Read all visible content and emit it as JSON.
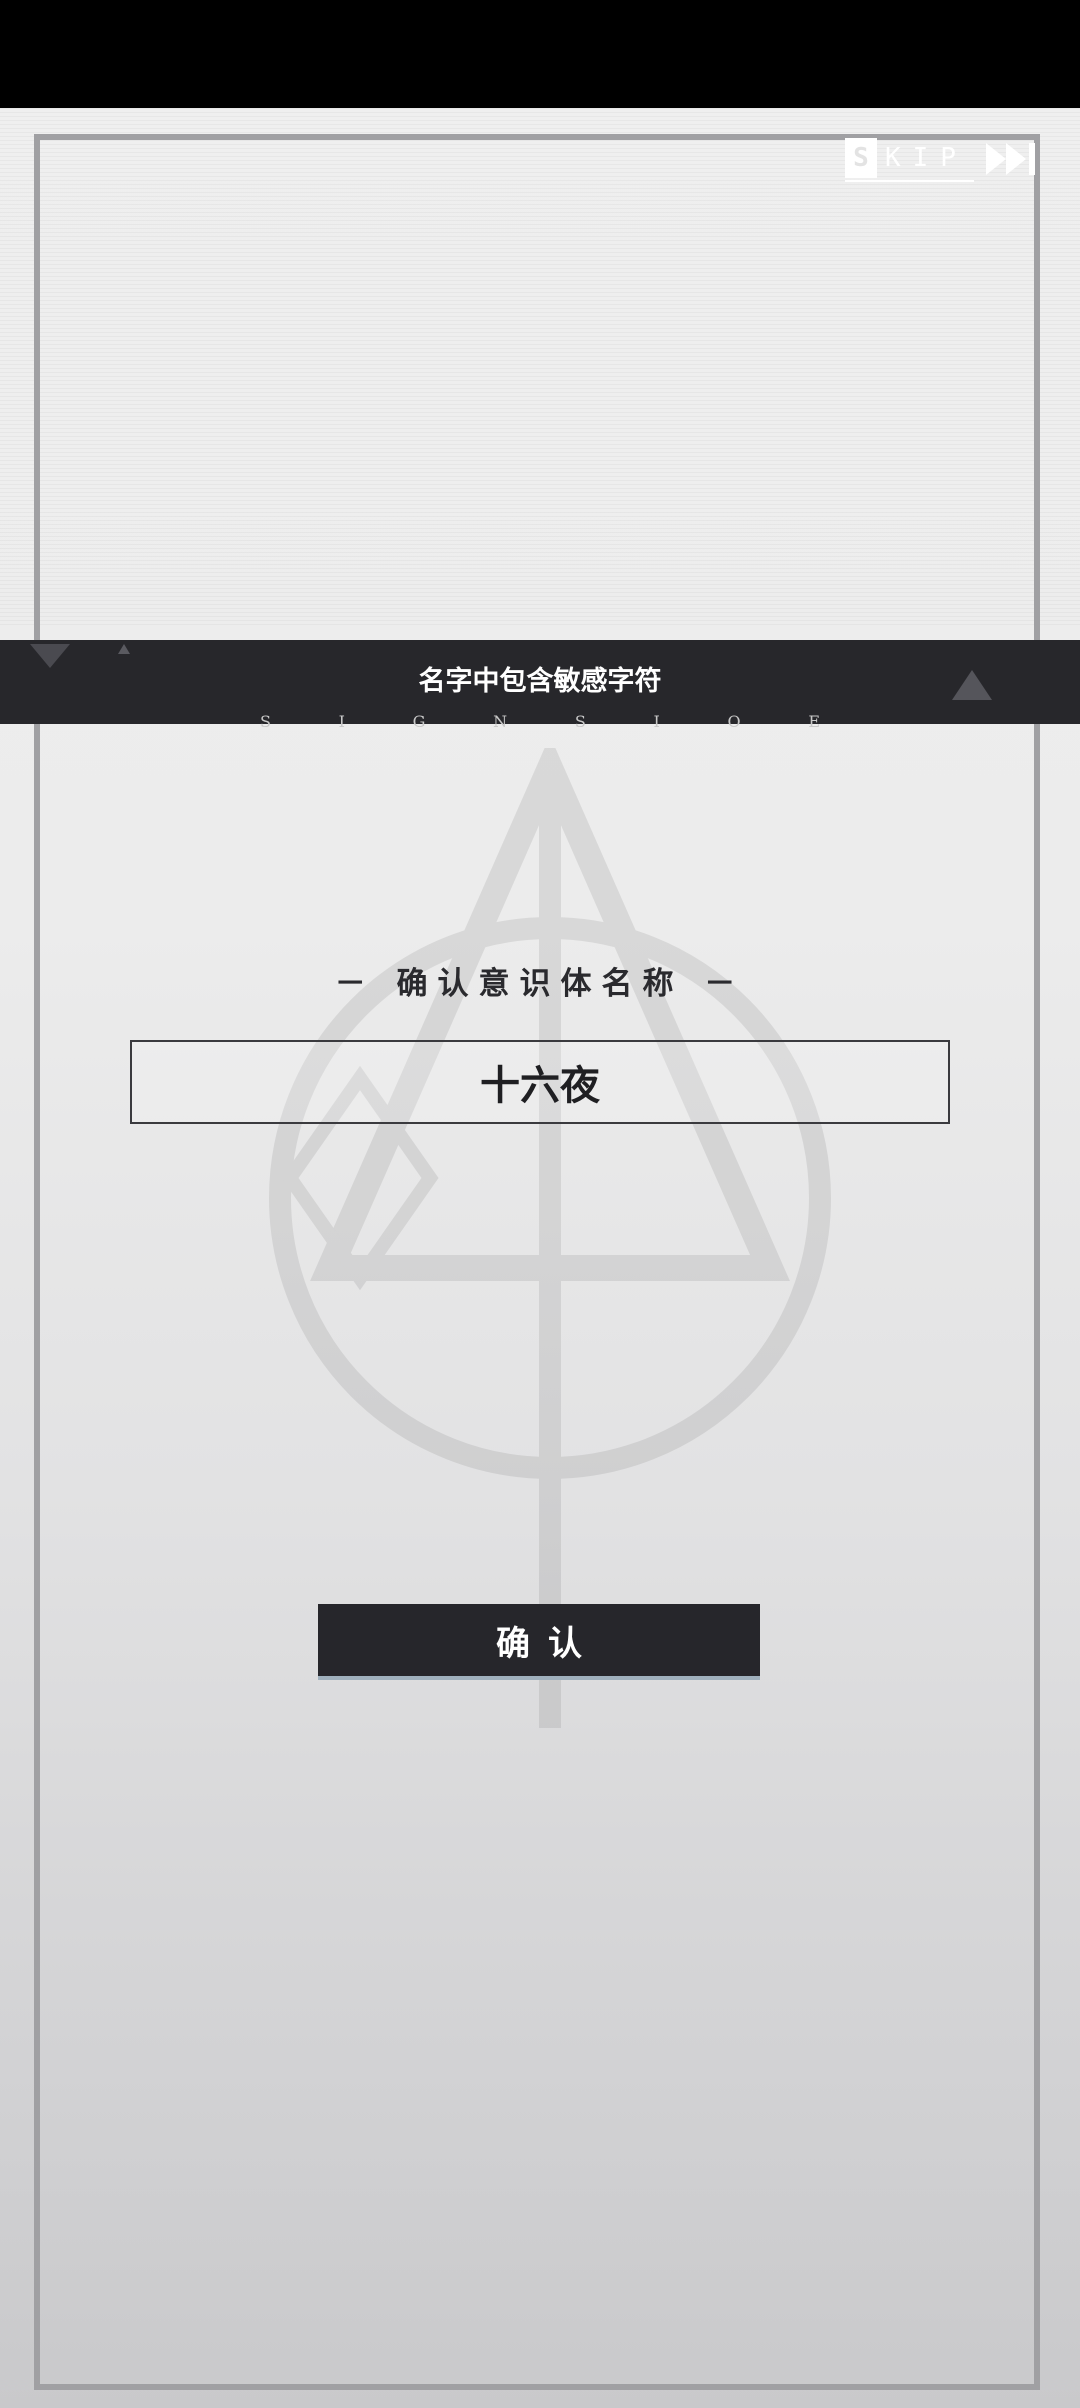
{
  "skip": {
    "label_first": "S",
    "label_rest": "KIP",
    "icon": "fast-forward-icon"
  },
  "banner": {
    "message": "名字中包含敏感字符",
    "left_icon": "chevron-down-icon",
    "right_icon": "triangle-up-icon",
    "under_letters": [
      "S",
      "I",
      "G",
      "N",
      "S",
      "I",
      "O",
      "E"
    ]
  },
  "dialog": {
    "title": "－ 确认意识体名称 －",
    "name_value": "十六夜",
    "confirm_label": "确认"
  },
  "colors": {
    "banner_bg": "#27272b",
    "button_bg": "#26262b",
    "frame": "#a0a0a3",
    "status_bar": "#000000"
  }
}
